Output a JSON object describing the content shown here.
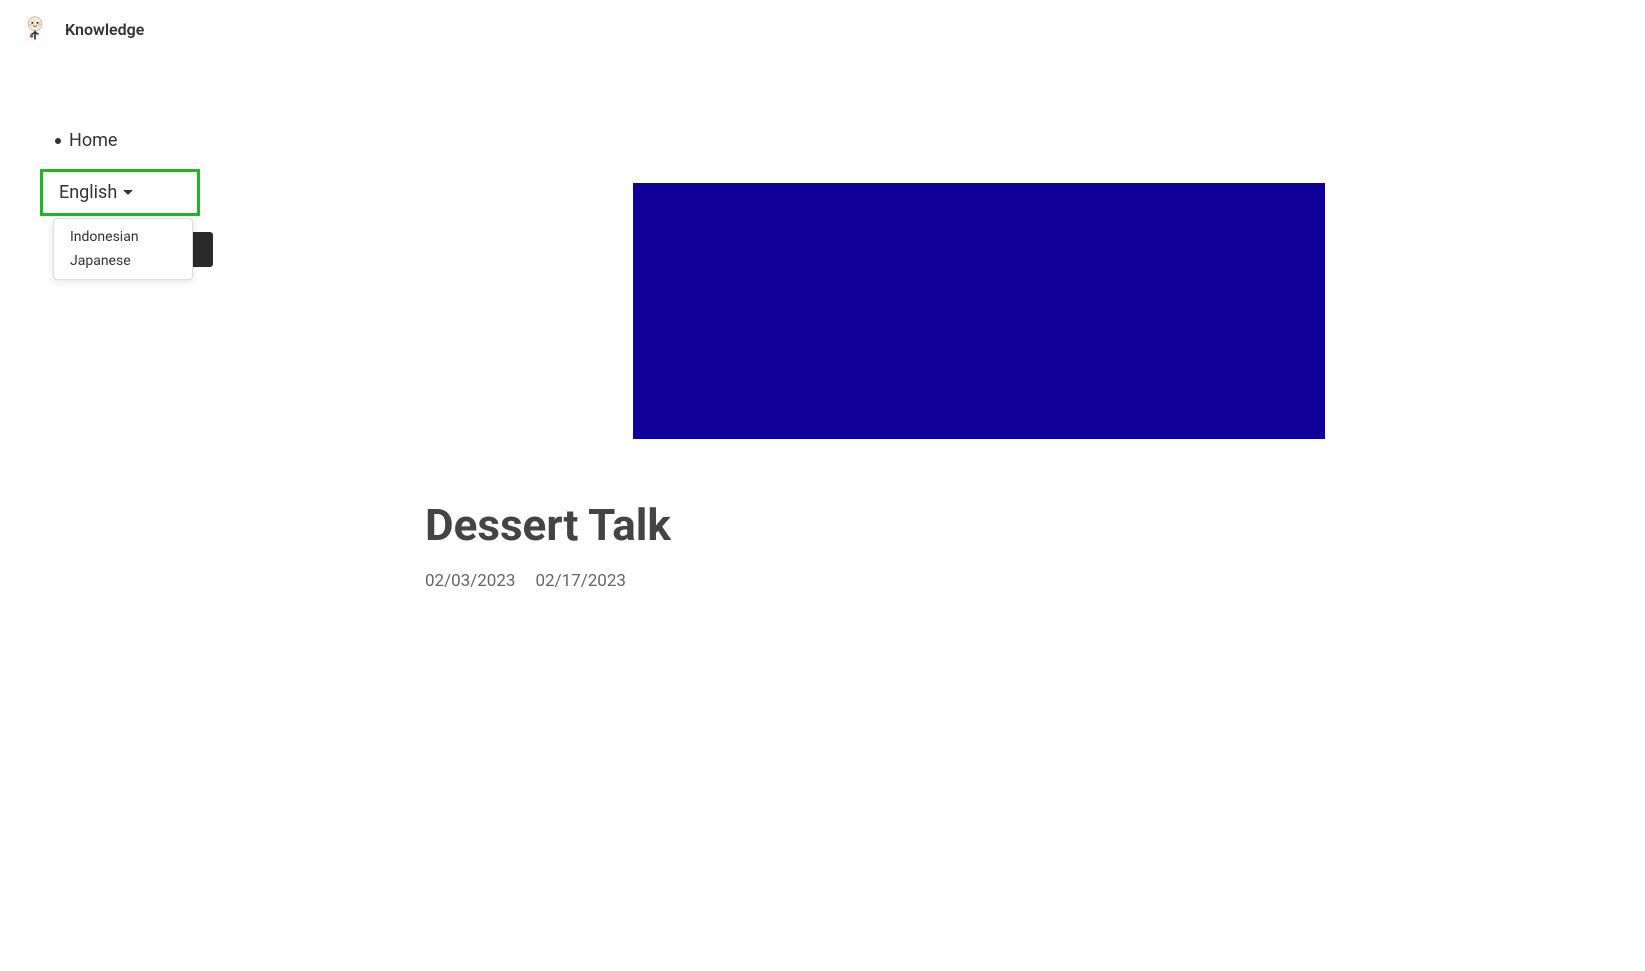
{
  "header": {
    "site_title": "Knowledge"
  },
  "sidebar": {
    "nav_items": [
      {
        "label": "Home"
      }
    ],
    "language_selector": {
      "current": "English",
      "options": [
        {
          "label": "Indonesian"
        },
        {
          "label": "Japanese"
        }
      ]
    }
  },
  "article": {
    "title": "Dessert Talk",
    "date_published": "02/03/2023",
    "date_updated": "02/17/2023",
    "hero_color": "#0f0099"
  }
}
